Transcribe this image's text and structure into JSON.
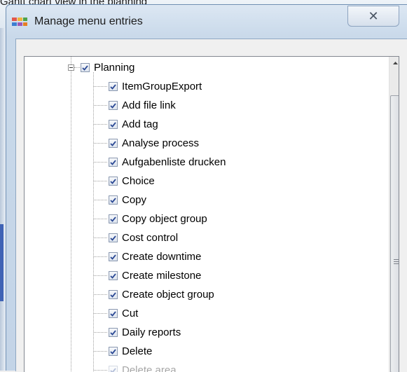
{
  "background": {
    "header_text": "Gantt chart view in the planning"
  },
  "window": {
    "title": "Manage menu entries",
    "close_glyph": "✕",
    "app_icon": "colored-menu-icon"
  },
  "tree": {
    "root": {
      "label": "Planning",
      "checked": true,
      "expanded": true
    },
    "items": [
      {
        "label": "ItemGroupExport",
        "checked": true
      },
      {
        "label": "Add file link",
        "checked": true
      },
      {
        "label": "Add tag",
        "checked": true
      },
      {
        "label": "Analyse process",
        "checked": true
      },
      {
        "label": "Aufgabenliste drucken",
        "checked": true
      },
      {
        "label": "Choice",
        "checked": true
      },
      {
        "label": "Copy",
        "checked": true
      },
      {
        "label": "Copy object group",
        "checked": true
      },
      {
        "label": "Cost control",
        "checked": true
      },
      {
        "label": "Create downtime",
        "checked": true
      },
      {
        "label": "Create milestone",
        "checked": true
      },
      {
        "label": "Create object group",
        "checked": true
      },
      {
        "label": "Cut",
        "checked": true
      },
      {
        "label": "Daily reports",
        "checked": true
      },
      {
        "label": "Delete",
        "checked": true
      },
      {
        "label": "Delete area",
        "checked": true
      }
    ]
  },
  "colors": {
    "check": "#2c4a95",
    "tree_line": "#a0a0a0"
  }
}
